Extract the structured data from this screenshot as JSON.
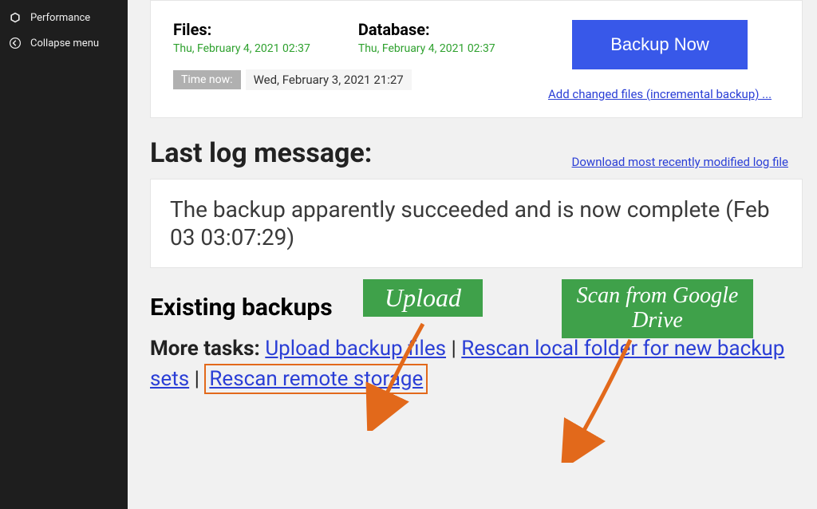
{
  "sidebar": {
    "items": [
      {
        "label": "Performance"
      },
      {
        "label": "Collapse menu"
      }
    ]
  },
  "status": {
    "files_label": "Files:",
    "files_date": "Thu, February 4, 2021 02:37",
    "db_label": "Database:",
    "db_date": "Thu, February 4, 2021 02:37",
    "time_now_label": "Time now:",
    "time_now_value": "Wed, February 3, 2021 21:27",
    "backup_button": "Backup Now",
    "incremental_link": "Add changed files (incremental backup) ..."
  },
  "log": {
    "title": "Last log message:",
    "download_link": "Download most recently modified log file",
    "message": "The backup apparently succeeded and is now complete (Feb 03 03:07:29)"
  },
  "existing": {
    "title": "Existing backups",
    "more_tasks_label": "More tasks:",
    "upload_link": "Upload backup files",
    "rescan_local_link": "Rescan local folder for new backup sets",
    "rescan_remote_link": "Rescan remote storage"
  },
  "annotations": {
    "upload": "Upload",
    "scan": "Scan from Google Drive"
  }
}
